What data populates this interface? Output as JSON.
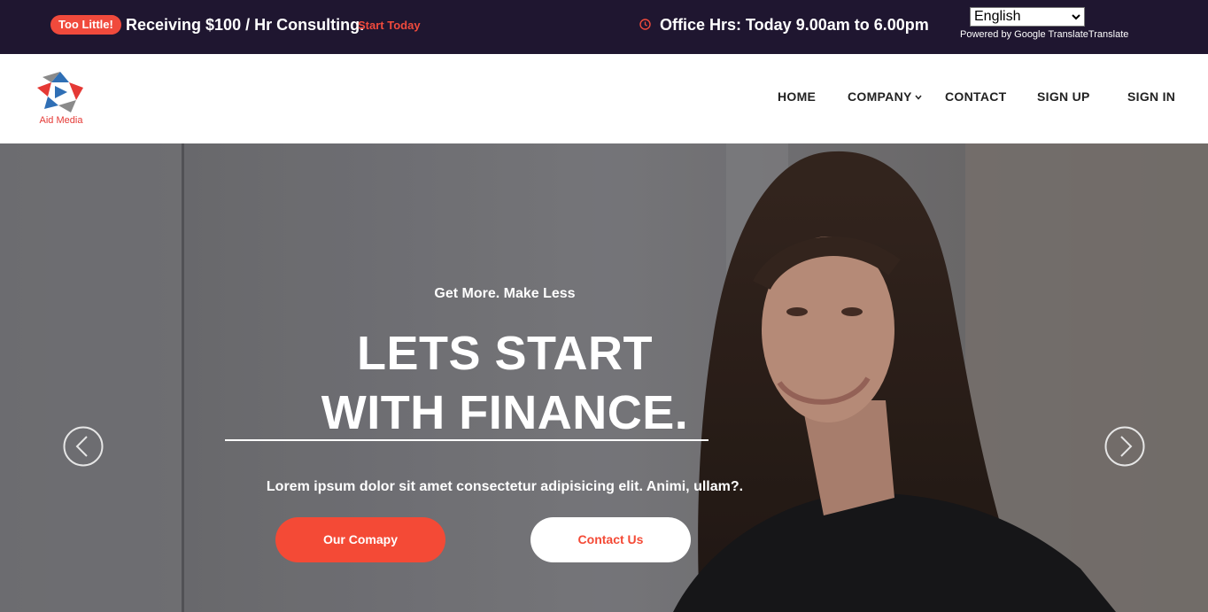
{
  "topbar": {
    "badge": "Too Little!",
    "promo": "Receiving $100 / Hr Consulting.",
    "promo_link": "Start Today",
    "hours": "Office Hrs: Today 9.00am to 6.00pm",
    "language": "English",
    "powered_by": "Powered by Google TranslateTranslate",
    "accent_color": "#f04a3c",
    "background_color": "#1f1630"
  },
  "brand": {
    "name": "Aid Media"
  },
  "nav": {
    "home": "HOME",
    "company": "COMPANY",
    "contact": "CONTACT",
    "sign_up": "SIGN UP",
    "sign_in": "SIGN IN"
  },
  "hero": {
    "eyebrow": "Get More. Make Less",
    "headline_line1": "LETS START",
    "headline_line2": "WITH FINANCE.",
    "lead": "Lorem ipsum dolor sit amet consectetur adipisicing elit. Animi, ullam?.",
    "primary_button": "Our Comapy",
    "secondary_button": "Contact Us",
    "button_color": "#f44a36",
    "prev_icon": "chevron-left-icon",
    "next_icon": "chevron-right-icon"
  }
}
